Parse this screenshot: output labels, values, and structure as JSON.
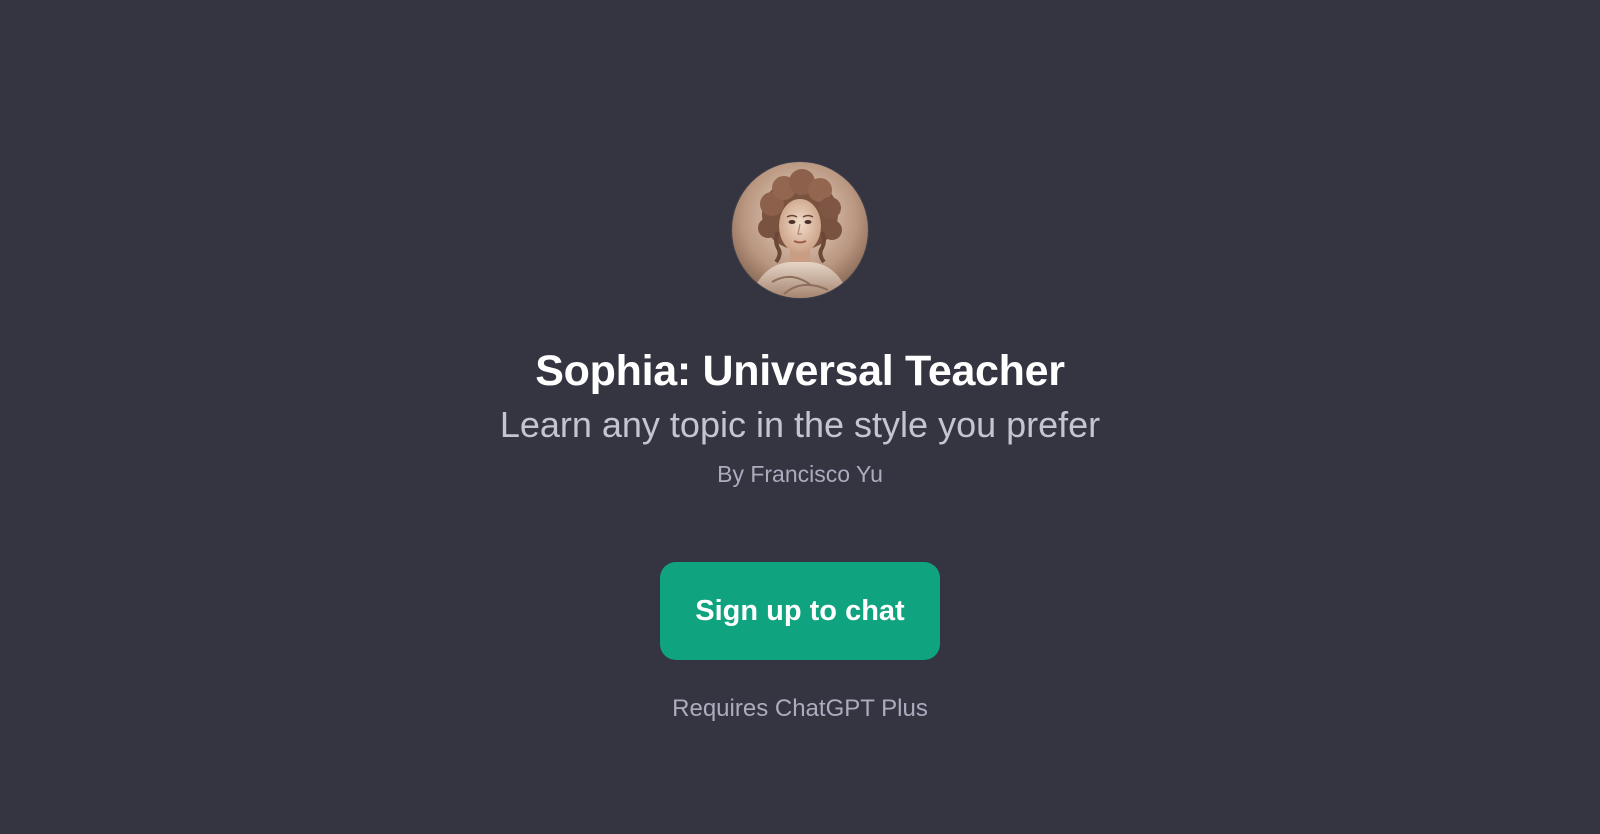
{
  "gpt": {
    "name": "Sophia: Universal Teacher",
    "description": "Learn any topic in the style you prefer",
    "author": "By Francisco Yu",
    "avatar_icon": "classical-woman-portrait"
  },
  "cta": {
    "label": "Sign up to chat"
  },
  "footer": {
    "requirement": "Requires ChatGPT Plus"
  },
  "colors": {
    "background": "#343541",
    "button": "#10a37f",
    "title": "#ffffff",
    "subtitle": "#c5c5d2",
    "muted": "#acacbe"
  }
}
